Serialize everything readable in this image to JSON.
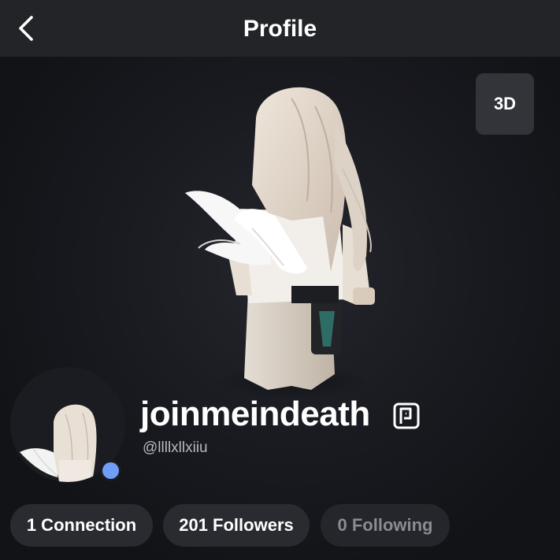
{
  "header": {
    "title": "Profile",
    "back_icon": "chevron-left-icon"
  },
  "viewer": {
    "toggle_label": "3D"
  },
  "profile": {
    "display_name": "joinmeindeath",
    "username": "@llllxllxiiu",
    "premium_icon": "premium-badge-icon",
    "online_status_color": "#6e9ef8"
  },
  "stats": {
    "connections_label": "1 Connection",
    "followers_label": "201 Followers",
    "following_label": "0 Following"
  },
  "colors": {
    "background": "#121317",
    "header": "#232428",
    "pill": "#2a2b31",
    "text": "#ffffff",
    "muted_text": "#b7b9c0"
  }
}
